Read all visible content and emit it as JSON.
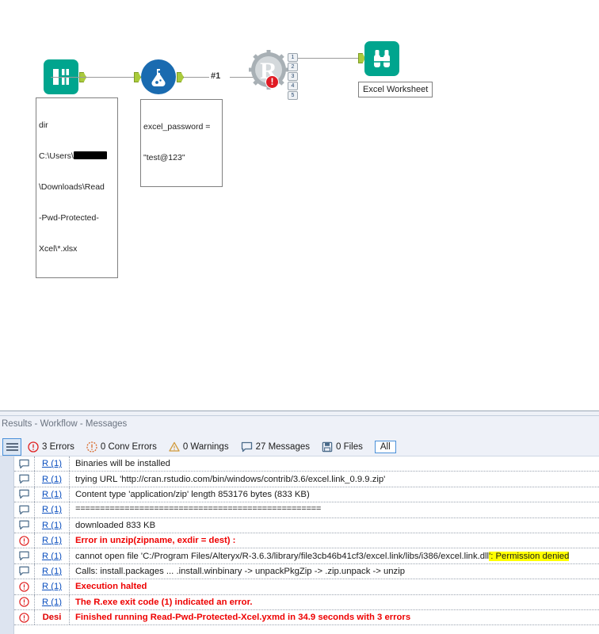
{
  "canvas": {
    "nodes": [
      {
        "name": "directory-tool",
        "icon": "directory-book-icon",
        "annotation": "dir\nC:\\Users\\[REDACTED]\\Downloads\\Read-Pwd-Protected-Xcel\\*.xlsx",
        "annotation_lines": [
          "dir",
          "C:\\Users\\",
          "\\Downloads\\Read",
          "-Pwd-Protected-",
          "Xcel\\*.xlsx"
        ]
      },
      {
        "name": "formula-tool",
        "icon": "formula-flask-icon",
        "annotation_lines": [
          "excel_password =",
          "\"test@123\""
        ]
      },
      {
        "name": "r-tool",
        "icon": "r-gear-icon",
        "status": "error",
        "anchors": [
          "1",
          "2",
          "3",
          "4",
          "5"
        ]
      },
      {
        "name": "browse-tool",
        "icon": "browse-binoculars-icon",
        "label": "Excel Worksheet"
      }
    ],
    "connection_label": "#1"
  },
  "results": {
    "title": "Results - Workflow - Messages",
    "toolbar": {
      "errors": "3 Errors",
      "conv_errors": "0 Conv Errors",
      "warnings": "0 Warnings",
      "messages": "27 Messages",
      "files": "0 Files",
      "filter": "All"
    },
    "columns": [
      "icon",
      "tool",
      "message"
    ],
    "rows": [
      {
        "icon": "message-bubble-icon",
        "tool": "R (1)",
        "type": "message",
        "text": "Binaries will be installed",
        "indent": true
      },
      {
        "icon": "message-bubble-icon",
        "tool": "R (1)",
        "type": "message",
        "text": "trying URL 'http://cran.rstudio.com/bin/windows/contrib/3.6/excel.link_0.9.9.zip'"
      },
      {
        "icon": "message-bubble-icon",
        "tool": "R (1)",
        "type": "message",
        "text": "Content type 'application/zip' length 853176 bytes (833 KB)"
      },
      {
        "icon": "message-bubble-icon",
        "tool": "R (1)",
        "type": "message",
        "text": "==================================================",
        "mono": true
      },
      {
        "icon": "message-bubble-icon",
        "tool": "R (1)",
        "type": "message",
        "text": "downloaded 833 KB"
      },
      {
        "icon": "error-icon",
        "tool": "R (1)",
        "type": "error",
        "text": "Error in unzip(zipname, exdir = dest) :"
      },
      {
        "icon": "message-bubble-icon",
        "tool": "R (1)",
        "type": "message",
        "text": "   cannot open file 'C:/Program Files/Alteryx/R-3.6.3/library/file3cb46b41cf3/excel.link/libs/i386/excel.link.dll",
        "highlight_text": "': Permission denied"
      },
      {
        "icon": "message-bubble-icon",
        "tool": "R (1)",
        "type": "message",
        "text": "Calls: install.packages ... .install.winbinary -> unpackPkgZip -> .zip.unpack -> unzip"
      },
      {
        "icon": "error-icon",
        "tool": "R (1)",
        "type": "error",
        "text": "Execution halted"
      },
      {
        "icon": "error-icon",
        "tool": "R (1)",
        "type": "error",
        "text": "The R.exe exit code (1) indicated an error."
      },
      {
        "icon": "error-icon",
        "tool": "Desi",
        "tool_plain": true,
        "type": "error",
        "text": "Finished running Read-Pwd-Protected-Xcel.yxmd in 34.9 seconds with 3 errors"
      }
    ]
  },
  "colors": {
    "teal": "#00a58e",
    "formula_blue": "#1a6bb0",
    "anchor_green": "#aacb3c",
    "error_red": "#ee0000",
    "highlight_yellow": "#ffff00",
    "panel_bg": "#eef1f8",
    "link_blue": "#0b4fbf"
  }
}
